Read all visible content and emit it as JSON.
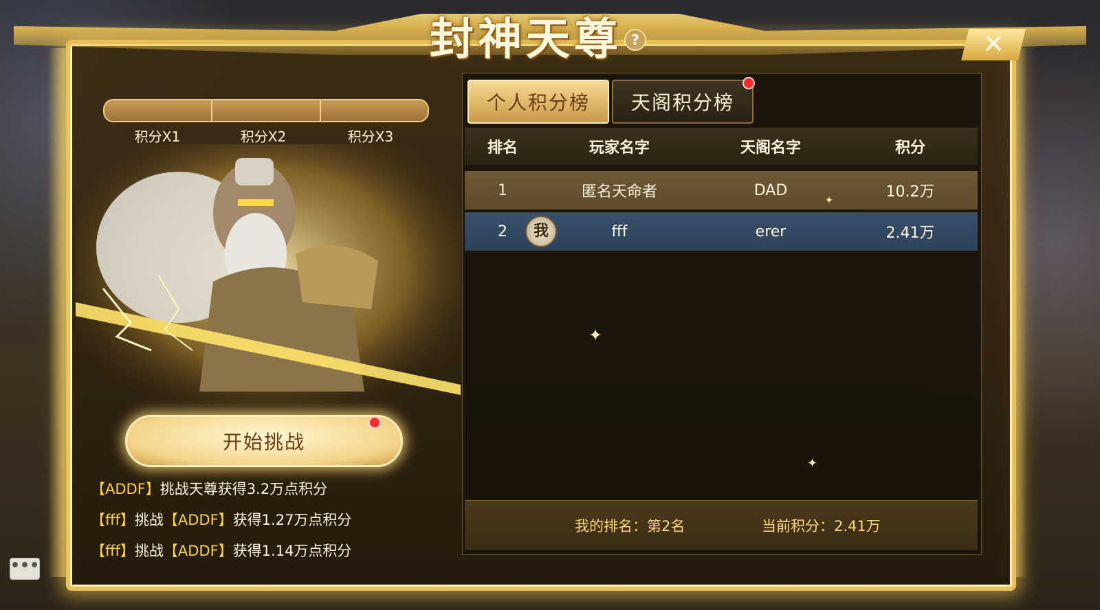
{
  "header": {
    "title": "封神天尊",
    "help_icon": "?"
  },
  "progress": {
    "ticks": [
      "积分X1",
      "积分X2",
      "积分X3"
    ]
  },
  "actions": {
    "start_label": "开始挑战"
  },
  "logs": [
    {
      "b1": "【",
      "name1": "ADDF",
      "b2": "】",
      "text": "挑战天尊获得3.2万点积分"
    },
    {
      "b1": "【",
      "name1": "fff",
      "b2": "】",
      "mid": "挑战",
      "b3": "【",
      "name2": "ADDF",
      "b4": "】",
      "text": "获得1.27万点积分"
    },
    {
      "b1": "【",
      "name1": "fff",
      "b2": "】",
      "mid": "挑战",
      "b3": "【",
      "name2": "ADDF",
      "b4": "】",
      "text": "获得1.14万点积分"
    }
  ],
  "tabs": [
    {
      "label": "个人积分榜",
      "active": true
    },
    {
      "label": "天阁积分榜",
      "active": false
    }
  ],
  "table": {
    "columns": [
      "排名",
      "玩家名字",
      "天阁名字",
      "积分"
    ],
    "rows": [
      {
        "rank": "1",
        "player": "匿名天命者",
        "guild": "DAD",
        "score": "10.2万"
      },
      {
        "rank": "2",
        "player": "fff",
        "guild": "erer",
        "score": "2.41万",
        "me_badge": "我"
      }
    ]
  },
  "footer": {
    "my_rank": "我的排名：第2名",
    "current_score": "当前积分：2.41万"
  },
  "chat_icon": "•••",
  "colors": {
    "gold": "#e9c35a",
    "highlight": "#ffd23c",
    "alert": "#ff2b2b"
  }
}
